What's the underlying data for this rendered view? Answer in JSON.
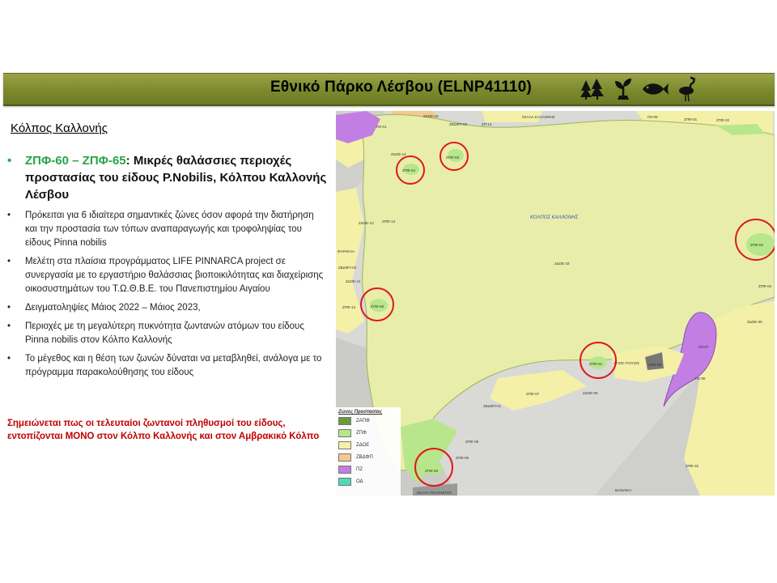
{
  "banner": {
    "title": "Εθνικό Πάρκο Λέσβου (ELNP41110)",
    "icons": [
      "trees-icon",
      "plant-icon",
      "fish-icon",
      "flamingo-icon"
    ]
  },
  "section_title": "Κόλπος Καλλονής",
  "main_point": {
    "highlight": "ΖΠΦ-60 – ΖΠΦ-65",
    "text": ": Μικρές θαλάσσιες περιοχές προστασίας του είδους P.Nobilis, Κόλπου Καλλονής Λέσβου"
  },
  "bullets": [
    "Πρόκειται για 6 ιδιαίτερα σημαντικές ζώνες όσον αφορά την διατήρηση και την προστασία των τόπων αναπαραγωγής και τροφοληψίας του είδους Pinna nobilis",
    "Μελέτη στα πλαίσια προγράμματος LIFE PINNARCA project σε συνεργασία με το εργαστήριο θαλάσσιας βιοποικιλότητας και διαχείρισης οικοσυστημάτων του  Τ.Ω.Θ.Β.Ε. του Πανεπιστημίου Αιγαίου",
    "Δειγματοληψίες Μάιος 2022 – Μάιος 2023,",
    "Περιοχές με τη μεγαλύτερη πυκνότητα ζωντανών ατόμων του είδους Pinna nobilis στον Κόλπο Καλλονής",
    "Το μέγεθος και η θέση των ζωνών δύναται να μεταβληθεί, ανάλογα με το πρόγραμμα παρακολούθησης του είδους"
  ],
  "note": "Σημειώνεται πως οι τελευταίοι ζωντανοί πληθυσμοί του είδους, εντοπίζονται ΜΟΝΟ στον Κόλπο Καλλονής και στον Αμβρακικό Κόλπο",
  "map": {
    "gulf_label": "ΚΟΛΠΟΣ ΚΑΛΛΟΝΗΣ",
    "zone_labels": [
      "ΠΖ-01",
      "ΖΔΟΕ-15",
      "ΖΒΔΦΠ-03",
      "ΖΠ-14",
      "ΣΚΑΛΑ ΚΑΛΛΟΝΗΣ",
      "ΠΖ-05",
      "ΖΠΦ-01",
      "ΖΠΦ-02",
      "ΖΔΟΕ-14",
      "ΖΠΦ-63",
      "ΖΠΦ-64",
      "ΖΔΟΕ-13",
      "ΖΠΦ-13",
      "ΖΠΦ-62",
      "ΖΔΟΕ-34",
      "ΖΒΔΦΠ-02",
      "ΖΔΟΕ-11",
      "ΖΠΦ-12",
      "ΖΠΦ-65",
      "ΖΠΦ-04",
      "ΖΔΟΕ-05",
      "ΠΖ-07",
      "ΖΠΦ-61",
      "ΖΠΦ-06",
      "ΠΖ-06",
      "ΖΔΟΕ-06",
      "ΖΠΦ-07",
      "ΖΒΔΦΠ-01",
      "ΖΠΦ-08",
      "ΖΠΦ-60",
      "ΖΠΦ-09",
      "ΖΠΦ-32",
      "ΣΚΑΛΑ ΠΟΛΙΧΝΙΤΟΥ",
      "ΒΑΣΙΛΙΚΑ",
      "ΑΓΙΟΣ ΠΑΥΛΟΣ",
      "ΦΑΡΑΚΛΑ"
    ],
    "circled_zones": [
      "ΖΠΦ-63",
      "ΖΠΦ-64",
      "ΖΠΦ-62",
      "ΖΠΦ-65",
      "ΖΠΦ-61",
      "ΖΠΦ-60"
    ],
    "legend": {
      "title": "Ζώνες Προστασίας",
      "items": [
        {
          "label": "ΖΑΠΦ",
          "color": "#6b9a3a"
        },
        {
          "label": "ΖΠΦ",
          "color": "#b8e68a"
        },
        {
          "label": "ΖΔΟΕ",
          "color": "#f4f0a8"
        },
        {
          "label": "ΖΒΔΦΠ",
          "color": "#f2c98e"
        },
        {
          "label": "ΠΖ",
          "color": "#c27ee3"
        },
        {
          "label": "ΟΔ",
          "color": "#4fd8b9"
        }
      ]
    }
  }
}
